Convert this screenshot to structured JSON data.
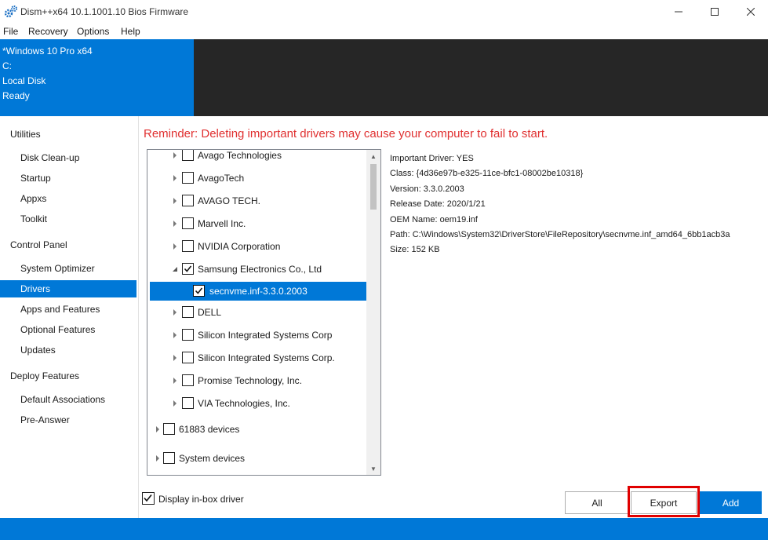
{
  "window": {
    "title": "Dism++x64 10.1.1001.10 Bios Firmware"
  },
  "menu": [
    "File",
    "Recovery",
    "Options",
    "Help"
  ],
  "header": {
    "lines": [
      "*Windows 10 Pro x64",
      "C:",
      "Local Disk",
      "Ready"
    ]
  },
  "sidebar": {
    "sections": [
      {
        "heading": "Utilities",
        "items": [
          "Disk Clean-up",
          "Startup",
          "Appxs",
          "Toolkit"
        ]
      },
      {
        "heading": "Control Panel",
        "items": [
          "System Optimizer",
          "Drivers",
          "Apps and Features",
          "Optional Features",
          "Updates"
        ]
      },
      {
        "heading": "Deploy Features",
        "items": [
          "Default Associations",
          "Pre-Answer"
        ]
      }
    ],
    "active_item": "Drivers"
  },
  "main": {
    "reminder": "Reminder: Deleting important drivers may cause your computer to fail to start."
  },
  "tree": {
    "rows": [
      {
        "label": "Avago Technologies",
        "level": 1,
        "expander": "collapsed",
        "checked": false,
        "selected": false
      },
      {
        "label": "AvagoTech",
        "level": 1,
        "expander": "collapsed",
        "checked": false,
        "selected": false
      },
      {
        "label": "AVAGO TECH.",
        "level": 1,
        "expander": "collapsed",
        "checked": false,
        "selected": false
      },
      {
        "label": "Marvell Inc.",
        "level": 1,
        "expander": "collapsed",
        "checked": false,
        "selected": false
      },
      {
        "label": "NVIDIA Corporation",
        "level": 1,
        "expander": "collapsed",
        "checked": false,
        "selected": false
      },
      {
        "label": "Samsung Electronics Co., Ltd",
        "level": 1,
        "expander": "expanded",
        "checked": true,
        "selected": false
      },
      {
        "label": "secnvme.inf-3.3.0.2003",
        "level": 2,
        "expander": "none",
        "checked": true,
        "selected": true
      },
      {
        "label": "DELL",
        "level": 1,
        "expander": "collapsed",
        "checked": false,
        "selected": false
      },
      {
        "label": "Silicon Integrated Systems Corp",
        "level": 1,
        "expander": "collapsed",
        "checked": false,
        "selected": false
      },
      {
        "label": "Silicon Integrated Systems Corp.",
        "level": 1,
        "expander": "collapsed",
        "checked": false,
        "selected": false
      },
      {
        "label": "Promise Technology, Inc.",
        "level": 1,
        "expander": "collapsed",
        "checked": false,
        "selected": false
      },
      {
        "label": "VIA Technologies, Inc.",
        "level": 1,
        "expander": "collapsed",
        "checked": false,
        "selected": false
      },
      {
        "label": "61883 devices",
        "level": 0,
        "expander": "collapsed",
        "checked": false,
        "selected": false
      },
      {
        "label": "System devices",
        "level": 0,
        "expander": "collapsed",
        "checked": false,
        "selected": false
      }
    ]
  },
  "details": {
    "lines": [
      "Important Driver: YES",
      "Class: {4d36e97b-e325-11ce-bfc1-08002be10318}",
      "Version: 3.3.0.2003",
      "Release Date: 2020/1/21",
      "OEM Name: oem19.inf",
      "Path: C:\\Windows\\System32\\DriverStore\\FileRepository\\secnvme.inf_amd64_6bb1acb3a",
      "Size: 152 KB"
    ]
  },
  "footer": {
    "inbox_label": "Display in-box driver",
    "inbox_checked": true,
    "buttons": {
      "all": "All",
      "export": "Export",
      "add": "Add"
    }
  },
  "colors": {
    "accent": "#0078d7",
    "header_dark": "#262626",
    "reminder": "#e03030",
    "highlight": "#e00000"
  }
}
